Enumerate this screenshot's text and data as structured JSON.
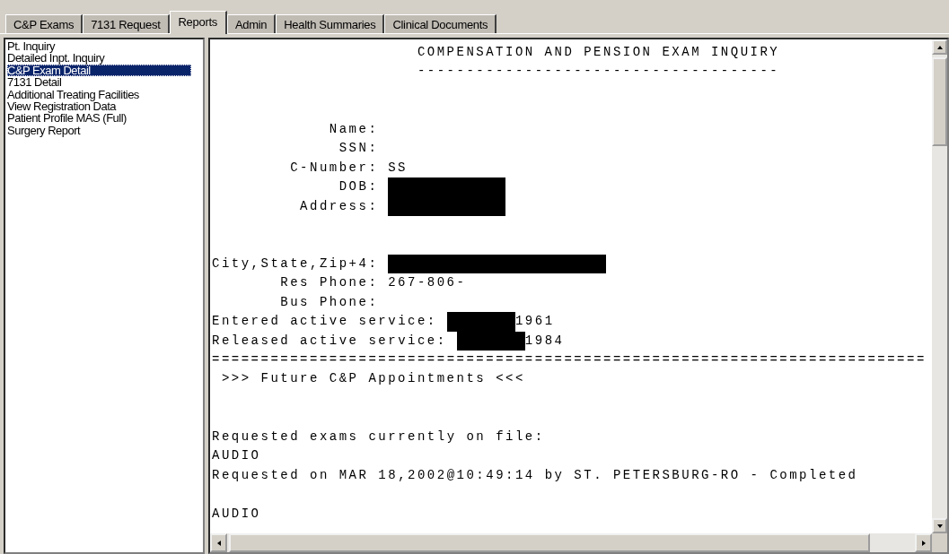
{
  "tabs": [
    {
      "label": "C&P Exams",
      "selected": false
    },
    {
      "label": "7131 Request",
      "selected": false
    },
    {
      "label": "Reports",
      "selected": true
    },
    {
      "label": "Admin",
      "selected": false
    },
    {
      "label": "Health Summaries",
      "selected": false
    },
    {
      "label": "Clinical Documents",
      "selected": false
    }
  ],
  "reports_list": {
    "items": [
      {
        "label": "Pt. Inquiry",
        "selected": false
      },
      {
        "label": "Detailed Inpt. Inquiry",
        "selected": false
      },
      {
        "label": "C&P Exam Detail",
        "selected": true
      },
      {
        "label": "7131 Detail",
        "selected": false
      },
      {
        "label": "Additional Treating Facilities",
        "selected": false
      },
      {
        "label": "View Registration Data",
        "selected": false
      },
      {
        "label": "Patient Profile MAS (Full)",
        "selected": false
      },
      {
        "label": "Surgery Report",
        "selected": false
      }
    ]
  },
  "report": {
    "lines": [
      {
        "kind": "heading",
        "text": "COMPENSATION AND PENSION EXAM INQUIRY"
      },
      {
        "kind": "heading",
        "text": "-------------------------------------"
      },
      {
        "kind": "blank"
      },
      {
        "kind": "blank"
      },
      {
        "kind": "field",
        "label": "Name:"
      },
      {
        "kind": "field",
        "label": "SSN:"
      },
      {
        "kind": "field",
        "label": "C-Number:",
        "value": "SS"
      },
      {
        "kind": "masked",
        "label": "DOB:"
      },
      {
        "kind": "masked",
        "label": "Address:"
      },
      {
        "kind": "blank"
      },
      {
        "kind": "blank"
      },
      {
        "kind": "maskedwide",
        "label": "City,State,Zip+4:"
      },
      {
        "kind": "field",
        "label": "Res Phone:",
        "value": "267-806-"
      },
      {
        "kind": "field",
        "label": "Bus Phone:"
      },
      {
        "kind": "service",
        "label": "Entered active service:",
        "value": "1961"
      },
      {
        "kind": "service",
        "label": "Released active service:",
        "value": "1984"
      },
      {
        "kind": "text",
        "text": "========================================================================="
      },
      {
        "kind": "subheading",
        "text": ">>> Future C&P Appointments <<<"
      },
      {
        "kind": "blank"
      },
      {
        "kind": "blank"
      },
      {
        "kind": "text",
        "text": "Requested exams currently on file:"
      },
      {
        "kind": "text",
        "text": "AUDIO"
      },
      {
        "kind": "text",
        "text": "Requested on MAR 18,2002@10:49:14 by ST. PETERSBURG-RO - Completed"
      },
      {
        "kind": "blank"
      },
      {
        "kind": "text",
        "text": "AUDIO"
      }
    ]
  }
}
